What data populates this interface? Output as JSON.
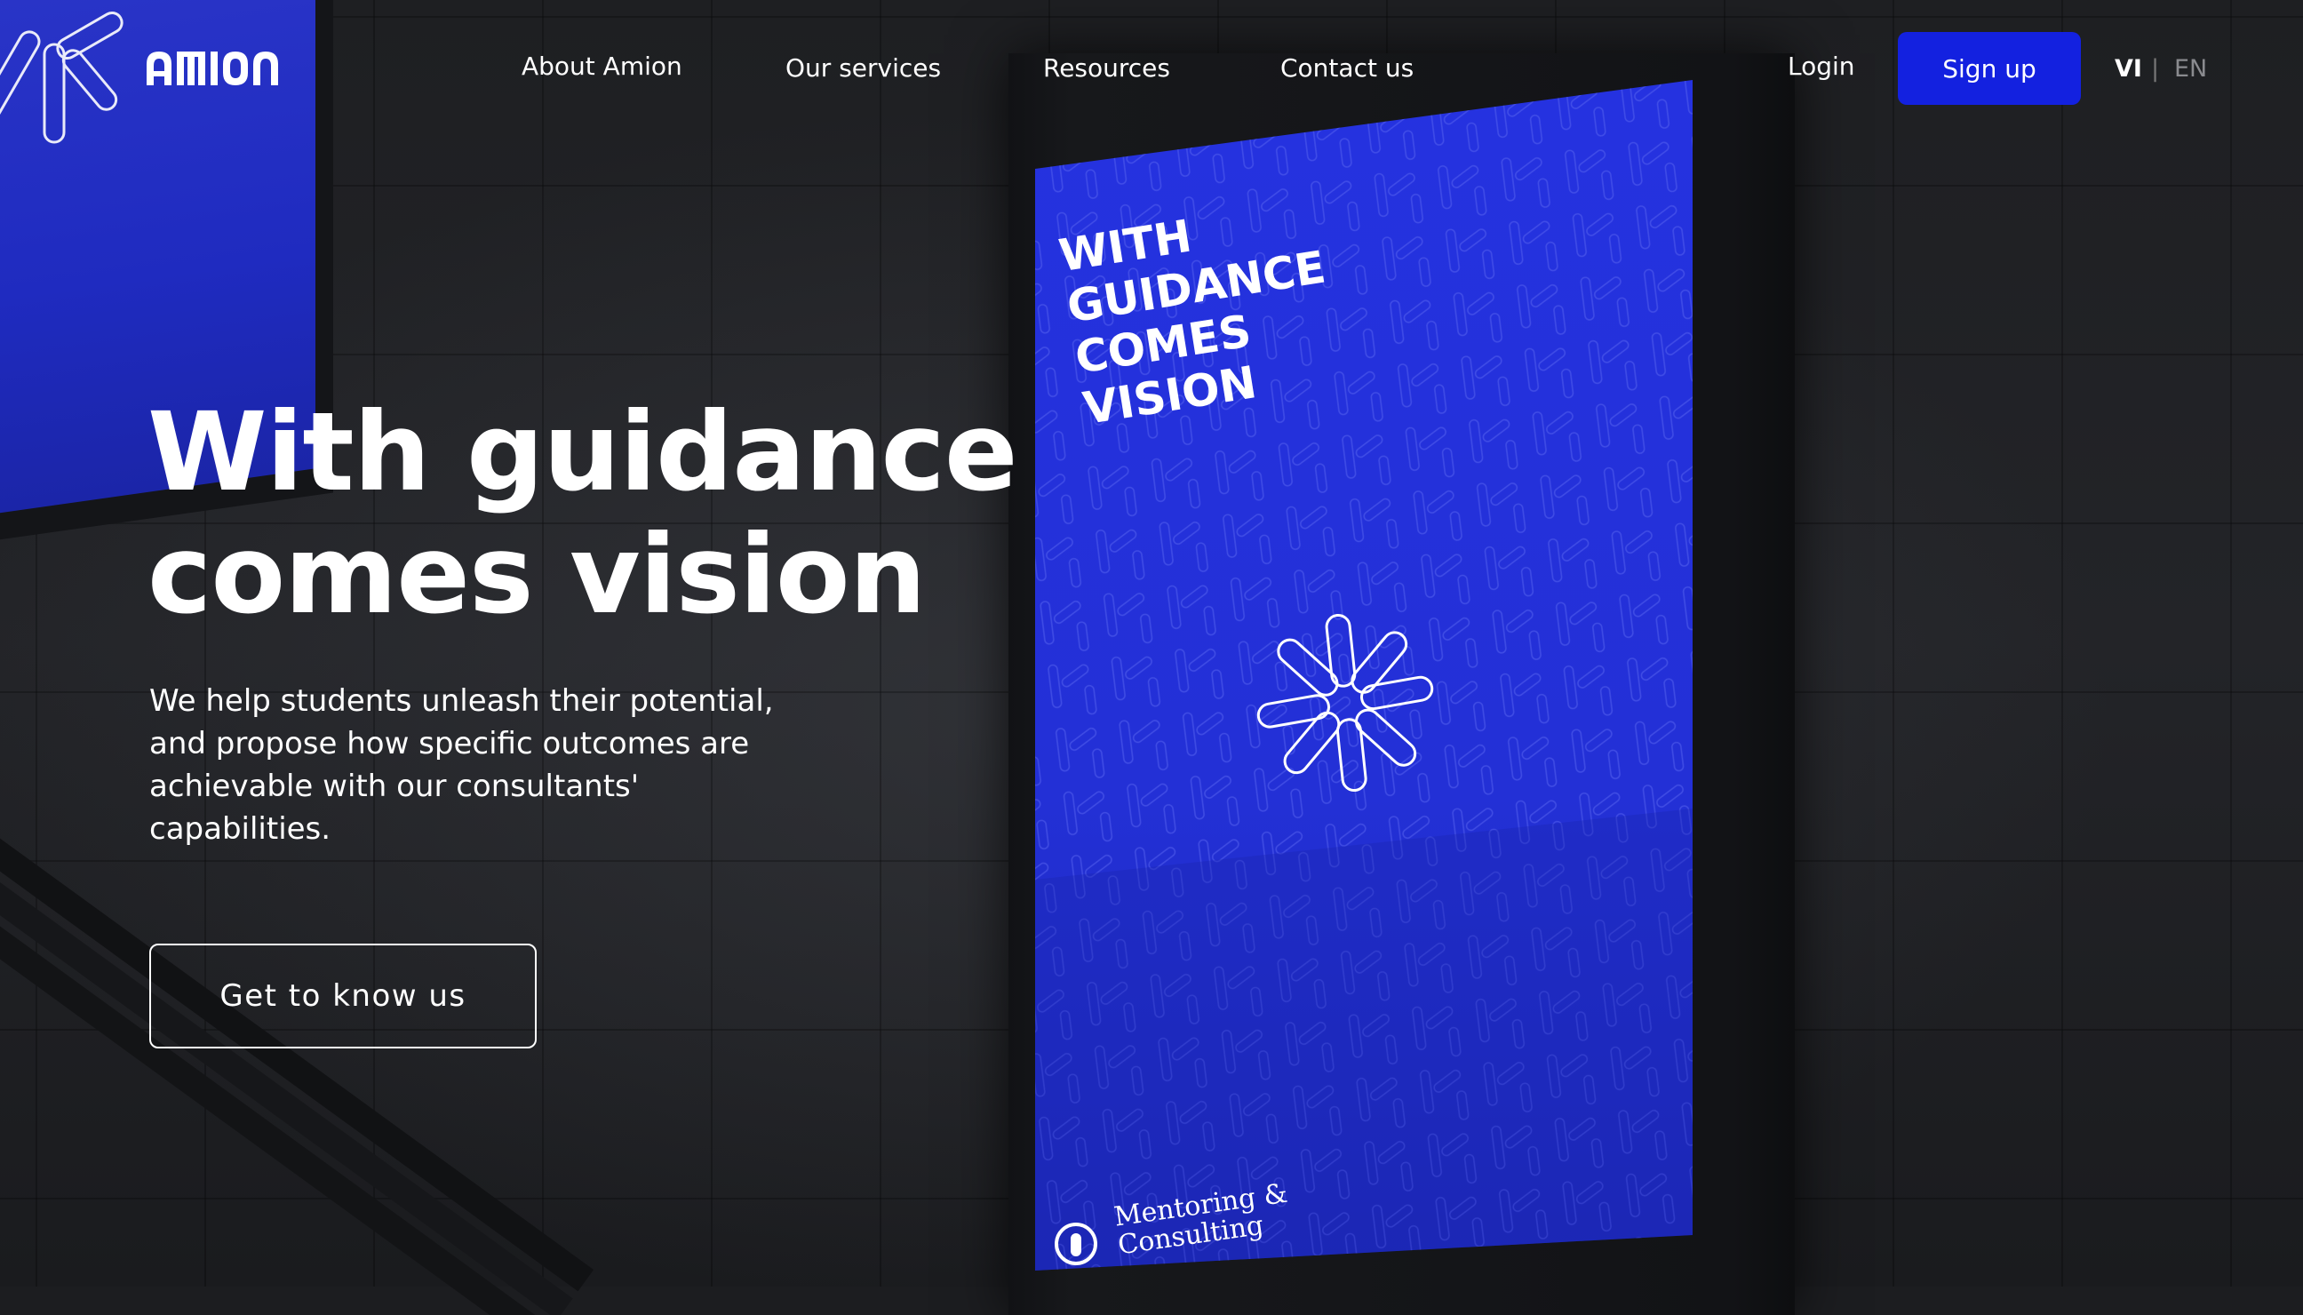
{
  "brand": {
    "logo_text": "amion"
  },
  "nav": {
    "items": [
      {
        "label": "About Amion"
      },
      {
        "label": "Our services"
      },
      {
        "label": "Resources"
      },
      {
        "label": "Contact us"
      }
    ],
    "login_label": "Login",
    "signup_label": "Sign up",
    "languages": {
      "vi": "VI",
      "separator": "|",
      "en": "EN",
      "active": "VI"
    }
  },
  "hero": {
    "title_line1": "With guidance",
    "title_line2": "comes vision",
    "description": "We help students unleash their potential, and propose how specific outcomes are achievable with our consultants' capabilities.",
    "cta_label": "Get to know us"
  },
  "poster": {
    "headline": "WITH\nGUIDANCE\nCOMES\nVISION",
    "tagline_line1": "Mentoring &",
    "tagline_line2": "Consulting"
  },
  "colors": {
    "accent": "#1321e0",
    "poster_blue": "#2430d8",
    "background": "#1c1d20"
  }
}
